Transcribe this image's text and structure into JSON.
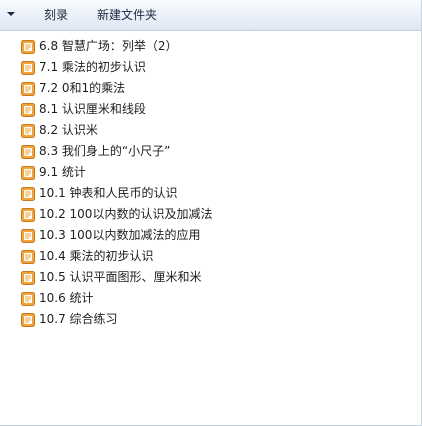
{
  "toolbar": {
    "dropdown_icon": "chevron-down-icon",
    "burn_label": "刻录",
    "new_folder_label": "新建文件夹"
  },
  "colors": {
    "folder_icon_body": "#f2a43a",
    "folder_icon_inner": "#ffffff",
    "toolbar_gradient_top": "#f9fbfe",
    "toolbar_gradient_bottom": "#dfe7f3"
  },
  "file_icon": "document-file-icon",
  "items": [
    {
      "label": "6.8  智慧广场：列举（2）"
    },
    {
      "label": "7.1 乘法的初步认识"
    },
    {
      "label": "7.2 0和1的乘法"
    },
    {
      "label": "8.1 认识厘米和线段"
    },
    {
      "label": "8.2 认识米"
    },
    {
      "label": "8.3 我们身上的“小尺子”"
    },
    {
      "label": "9.1 统计"
    },
    {
      "label": "10.1  钟表和人民币的认识"
    },
    {
      "label": "10.2 100以内数的认识及加减法"
    },
    {
      "label": "10.3 100以内数加减法的应用"
    },
    {
      "label": "10.4 乘法的初步认识"
    },
    {
      "label": "10.5 认识平面图形、厘米和米"
    },
    {
      "label": "10.6 统计"
    },
    {
      "label": "10.7 综合练习"
    }
  ]
}
